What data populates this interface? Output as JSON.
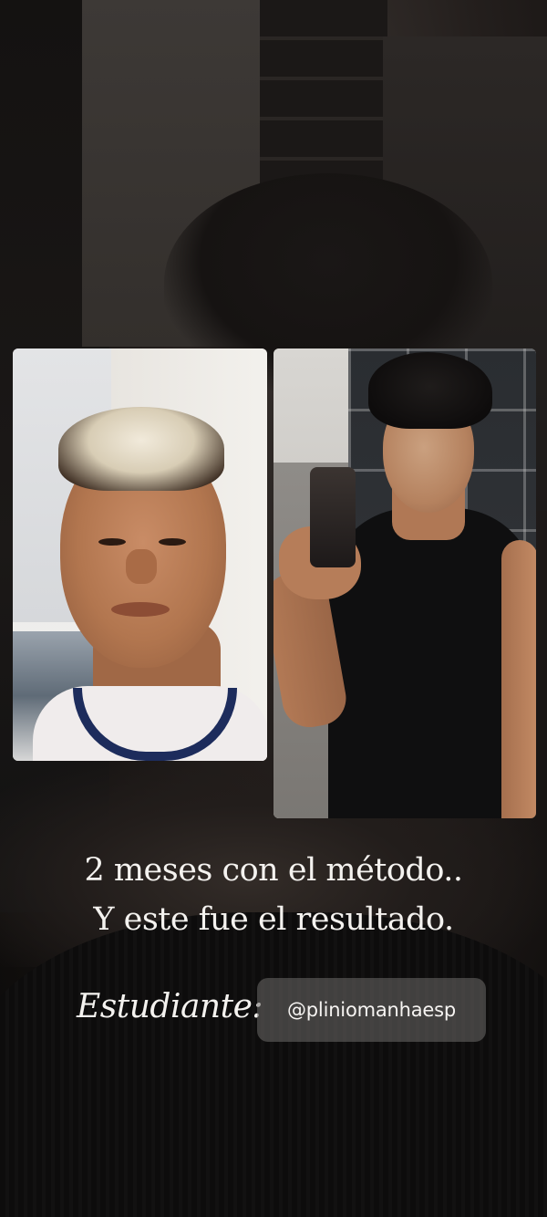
{
  "story": {
    "caption_line_1": "2 meses con el método..",
    "caption_line_2": "Y este fue el resultado.",
    "student_label": "Estudiante:",
    "mention": "@pliniomanhaesp"
  },
  "photos": [
    {
      "id": "before",
      "alt": "selfie before"
    },
    {
      "id": "after",
      "alt": "mirror selfie after"
    }
  ],
  "colors": {
    "text": "#f4f2ef",
    "chip_bg": "#6e6c6a",
    "background": "#141110"
  }
}
